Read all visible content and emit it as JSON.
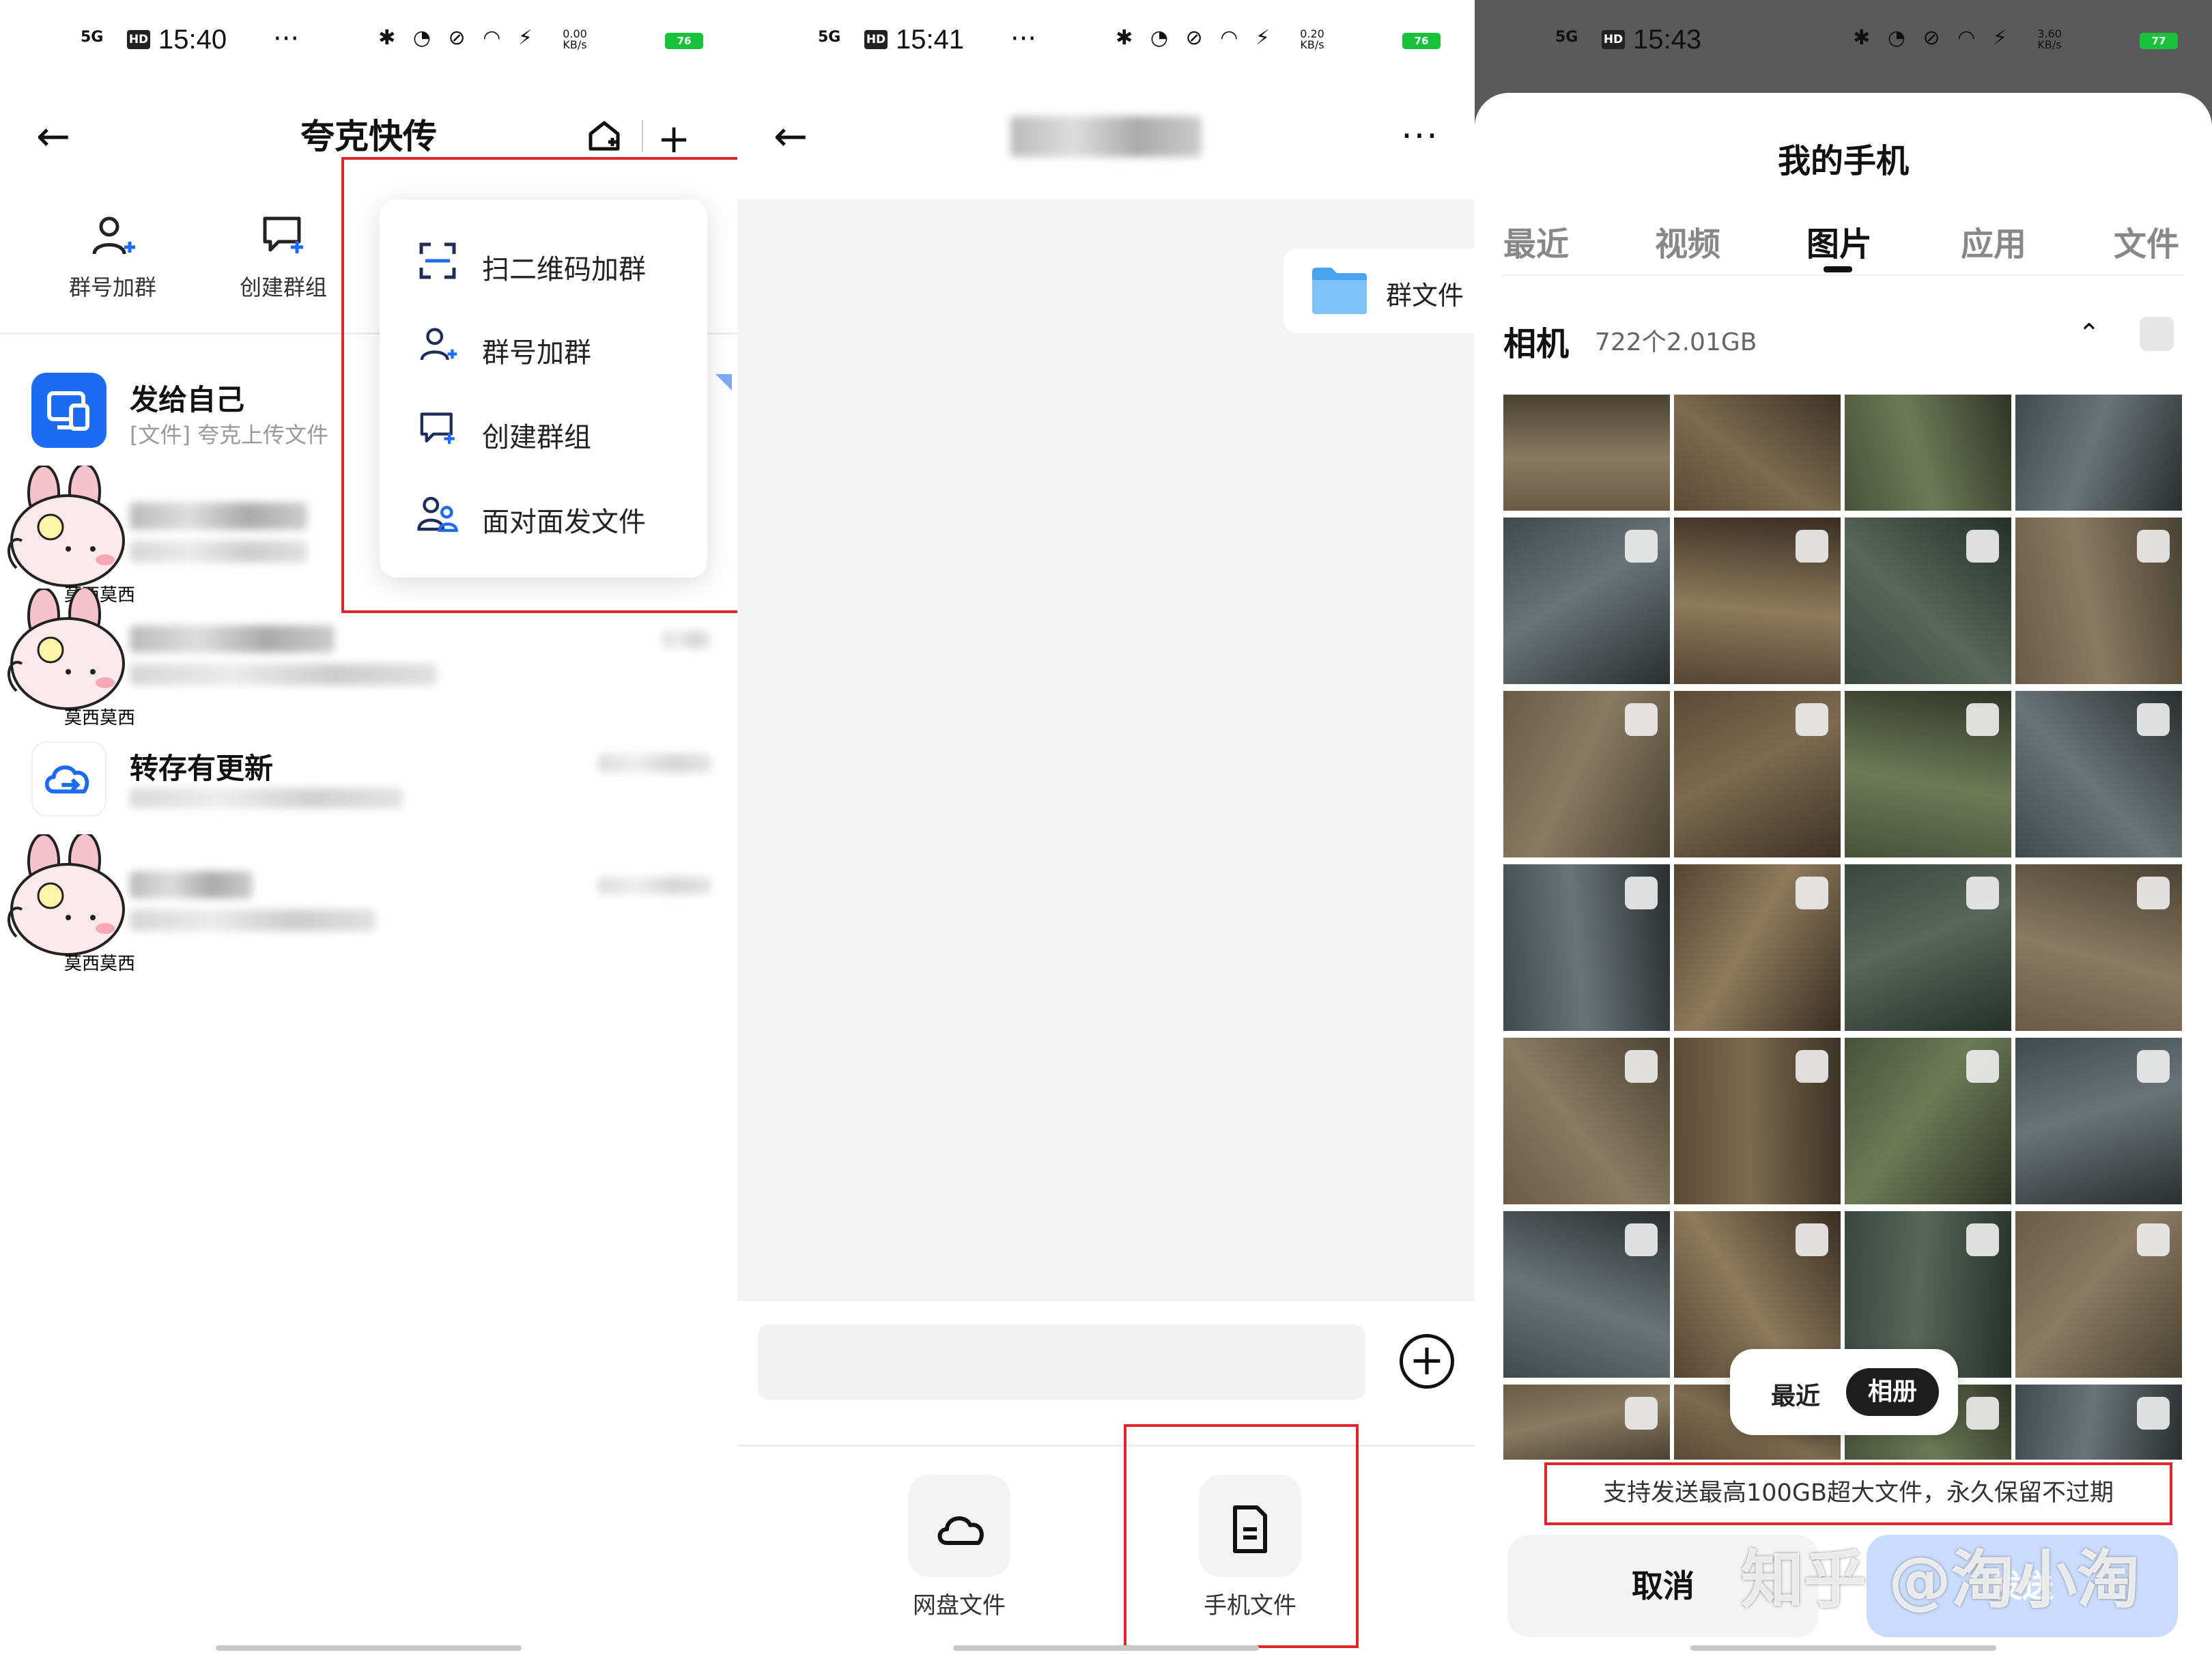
{
  "panel1": {
    "status": {
      "signal": "5G",
      "hd": "HD",
      "time": "15:40",
      "more": "···",
      "speed": "0.00 KB/s",
      "icons": "✱ ◔ ⊘ ◠ ⚡",
      "battery": "76"
    },
    "title": "夸克快传",
    "back_icon": "back-arrow-icon",
    "quick_actions": [
      {
        "label": "群号加群",
        "icon": "person-add-icon"
      },
      {
        "label": "创建群组",
        "icon": "chat-add-icon"
      }
    ],
    "conversations": [
      {
        "name": "发给自己",
        "sub": "[文件] 夸克上传文件"
      },
      {
        "name": "转存有更新"
      }
    ],
    "sticker_text": "莫西莫西",
    "menu": [
      {
        "label": "扫二维码加群",
        "icon": "scan-icon"
      },
      {
        "label": "群号加群",
        "icon": "person-add-icon"
      },
      {
        "label": "创建群组",
        "icon": "chat-add-icon"
      },
      {
        "label": "面对面发文件",
        "icon": "people-icon"
      }
    ]
  },
  "panel2": {
    "status": {
      "signal": "5G",
      "hd": "HD",
      "time": "15:41",
      "more": "···",
      "speed": "0.20 KB/s",
      "icons": "✱ ◔ ⊘ ◠ ⚡",
      "battery": "76"
    },
    "more_icon": "···",
    "folder_label": "群文件",
    "plus_icon": "+",
    "tools": [
      {
        "label": "网盘文件",
        "icon": "cloud-icon"
      },
      {
        "label": "手机文件",
        "icon": "file-icon"
      }
    ]
  },
  "panel3": {
    "status": {
      "signal": "5G",
      "hd": "HD",
      "time": "15:43",
      "speed": "3.60 KB/s",
      "icons": "✱ ◔ ⊘ ◠ ⚡",
      "battery": "77"
    },
    "title": "我的手机",
    "tabs": [
      "最近",
      "视频",
      "图片",
      "应用",
      "文件"
    ],
    "active_tab": "图片",
    "album": {
      "name": "相机",
      "meta": "722个2.01GB",
      "arrow": "⌃"
    },
    "segment": {
      "option1": "最近",
      "option2": "相册"
    },
    "notice": "支持发送最高100GB超大文件，永久保留不过期",
    "cancel_label": "取消",
    "send_label": "发送",
    "watermark": "知乎 @淘小淘"
  },
  "colors": {
    "accent_blue": "#1d6bf3",
    "highlight_red": "#e0262b",
    "battery_green": "#19c23a"
  }
}
